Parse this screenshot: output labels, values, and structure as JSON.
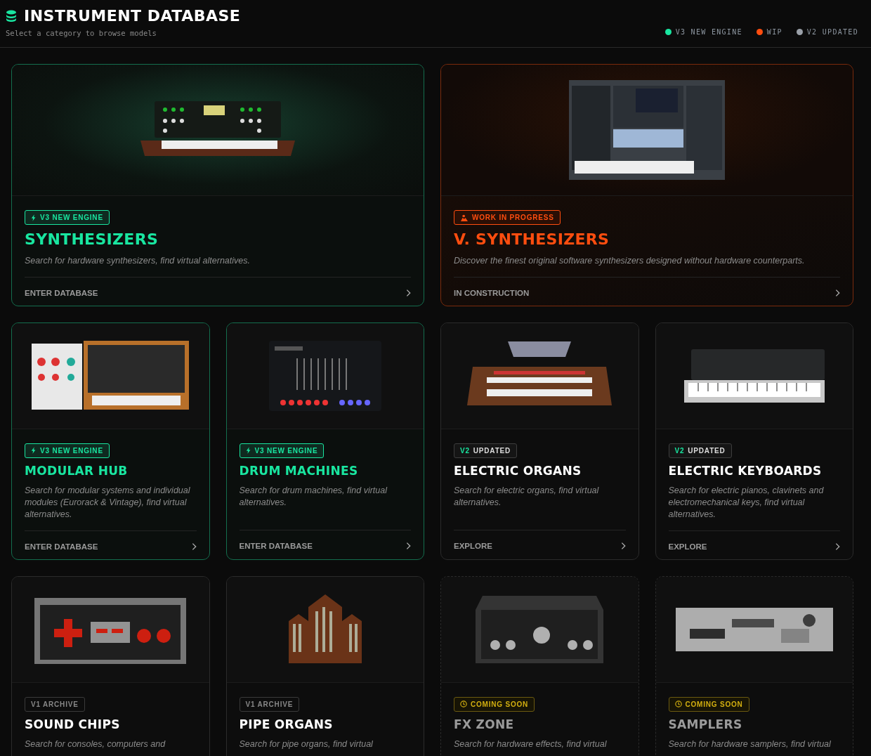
{
  "header": {
    "title": "INSTRUMENT DATABASE",
    "subtitle": "Select a category to browse models",
    "legend": [
      {
        "label": "V3 NEW ENGINE",
        "color": "#19e6a0"
      },
      {
        "label": "WIP",
        "color": "#ff4d0f"
      },
      {
        "label": "V2 UPDATED",
        "color": "#9aa0a8"
      }
    ]
  },
  "cards": [
    {
      "kind": "v3",
      "wide": true,
      "badge": {
        "text": "V3 NEW ENGINE"
      },
      "title": "SYNTHESIZERS",
      "description": "Search for hardware synthesizers, find virtual alternatives.",
      "link": "ENTER DATABASE"
    },
    {
      "kind": "wip",
      "wide": true,
      "badge": {
        "text": "WORK IN PROGRESS"
      },
      "title": "V. SYNTHESIZERS",
      "description": "Discover the finest original software synthesizers designed without hardware counterparts.",
      "link": "IN CONSTRUCTION"
    },
    {
      "kind": "v3",
      "wide": false,
      "badge": {
        "text": "V3 NEW ENGINE"
      },
      "title": "MODULAR HUB",
      "description": "Search for modular systems and individual modules (Eurorack & Vintage), find virtual alternatives.",
      "link": "ENTER DATABASE"
    },
    {
      "kind": "v3",
      "wide": false,
      "badge": {
        "text": "V3 NEW ENGINE"
      },
      "title": "DRUM MACHINES",
      "description": "Search for drum machines, find virtual alternatives.",
      "link": "ENTER DATABASE"
    },
    {
      "kind": "v2",
      "wide": false,
      "badge": {
        "highlight": "V2",
        "text": "UPDATED"
      },
      "title": "ELECTRIC ORGANS",
      "description": "Search for electric organs, find virtual alternatives.",
      "link": "EXPLORE"
    },
    {
      "kind": "v2",
      "wide": false,
      "badge": {
        "highlight": "V2",
        "text": "UPDATED"
      },
      "title": "ELECTRIC KEYBOARDS",
      "description": "Search for electric pianos, clavinets and electromechanical keys, find virtual alternatives.",
      "link": "EXPLORE"
    },
    {
      "kind": "v1",
      "wide": false,
      "badge": {
        "text": "V1 ARCHIVE"
      },
      "title": "SOUND CHIPS",
      "description": "Search for consoles, computers and"
    },
    {
      "kind": "v1",
      "wide": false,
      "badge": {
        "text": "V1 ARCHIVE"
      },
      "title": "PIPE ORGANS",
      "description": "Search for pipe organs, find virtual"
    },
    {
      "kind": "soon",
      "wide": false,
      "badge": {
        "text": "COMING SOON"
      },
      "title": "FX ZONE",
      "description": "Search for hardware effects, find virtual"
    },
    {
      "kind": "soon",
      "wide": false,
      "badge": {
        "text": "COMING SOON"
      },
      "title": "SAMPLERS",
      "description": "Search for hardware samplers, find virtual"
    }
  ]
}
